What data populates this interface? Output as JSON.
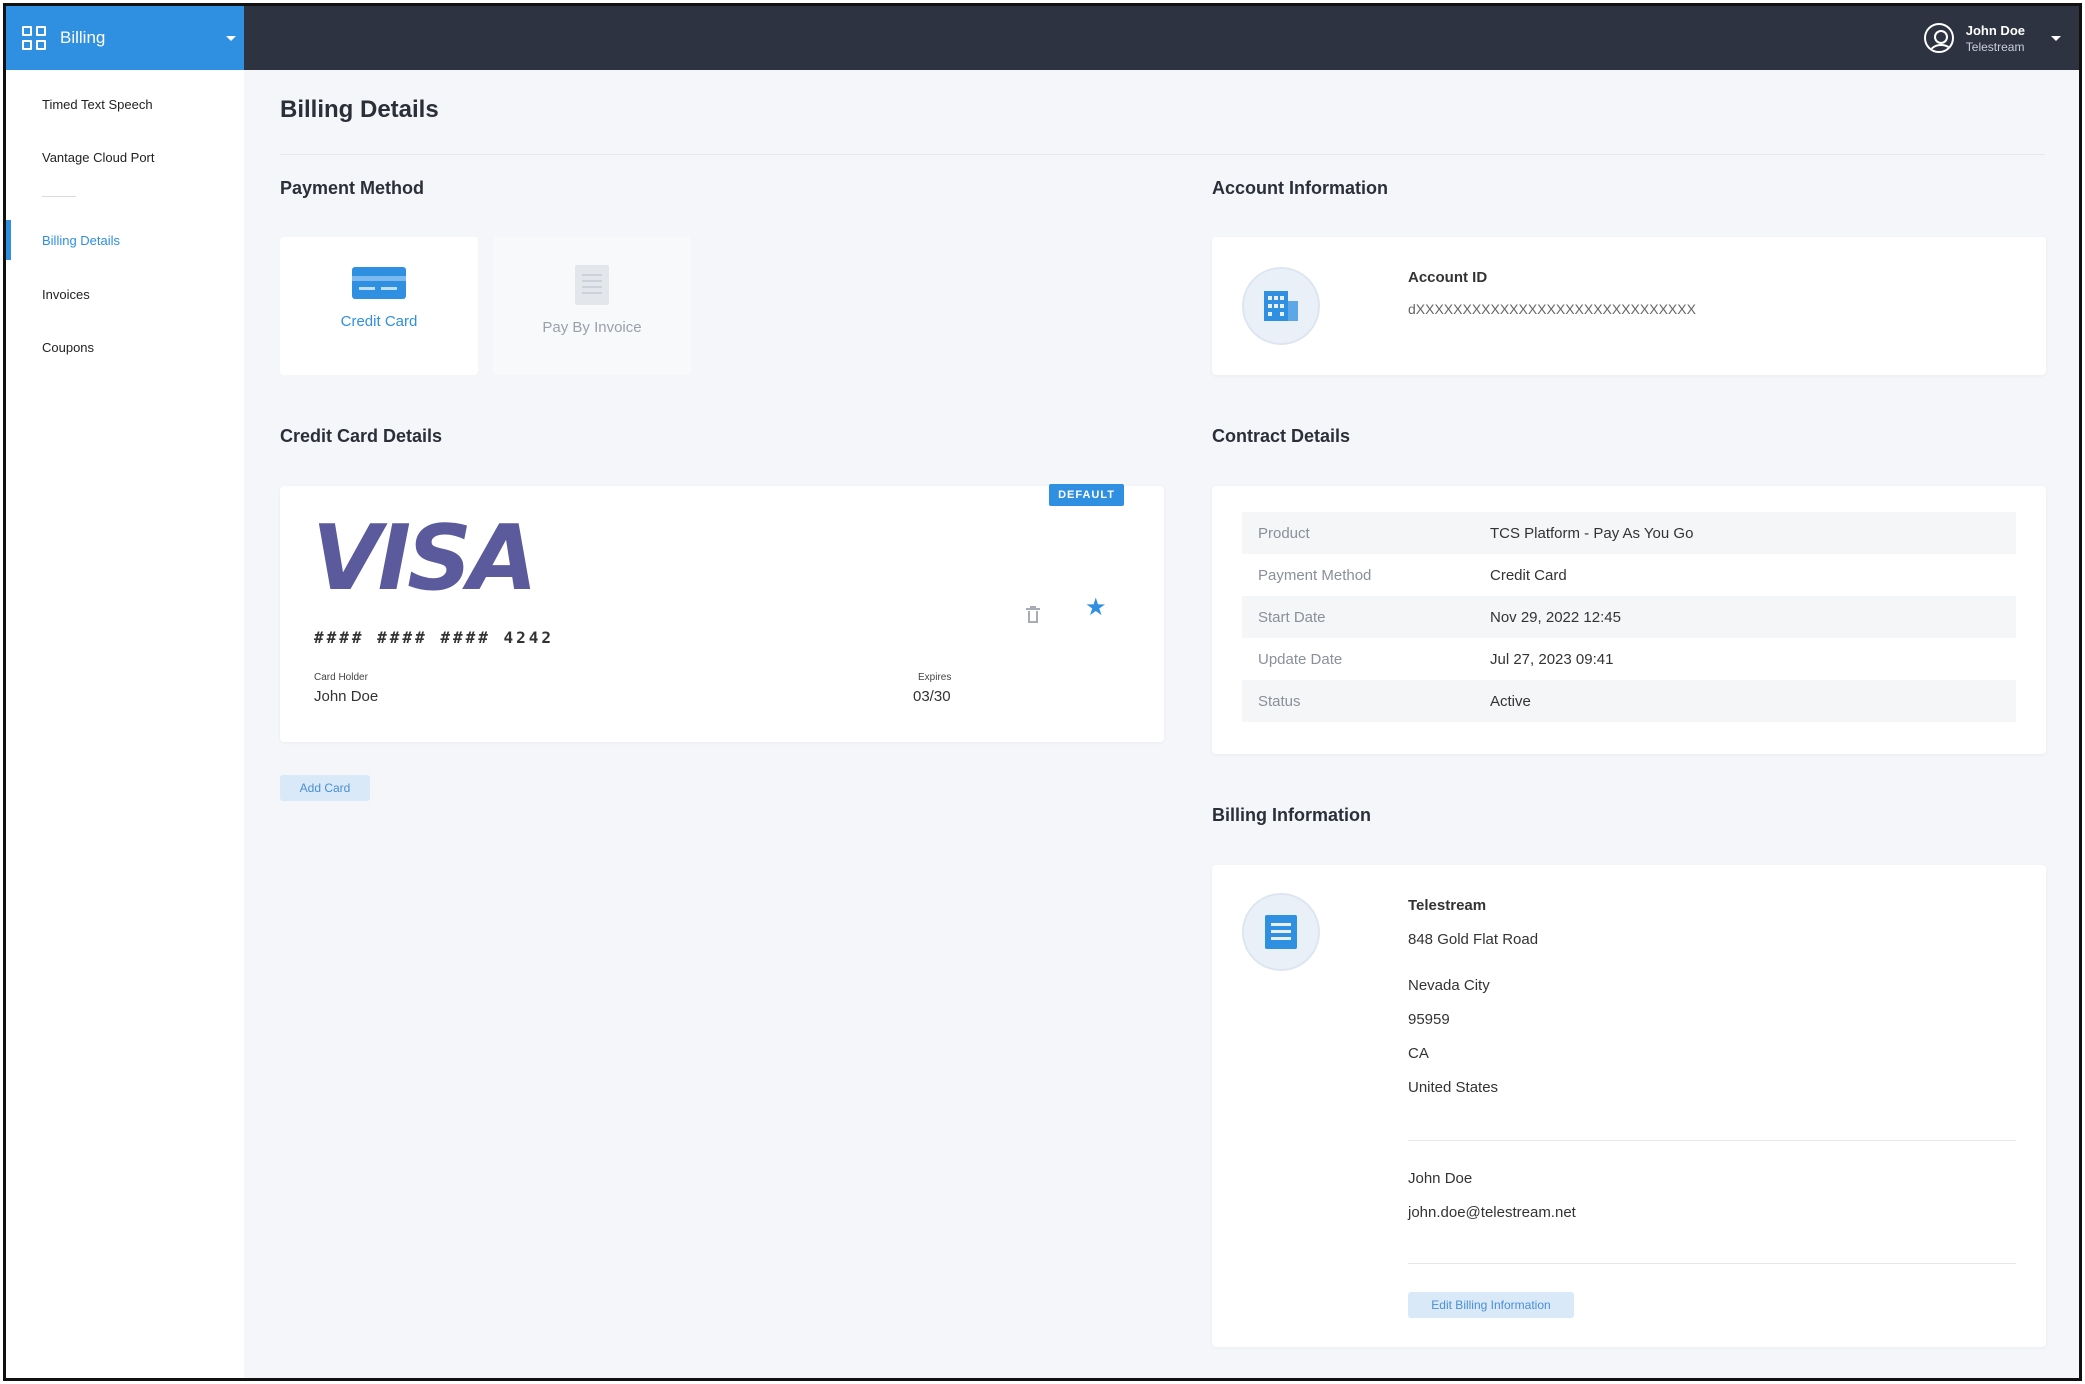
{
  "app": {
    "name": "Billing"
  },
  "user": {
    "name": "John Doe",
    "org": "Telestream"
  },
  "sidebar": {
    "items": [
      {
        "label": "Timed Text Speech"
      },
      {
        "label": "Vantage Cloud Port"
      },
      {
        "label": "Billing Details",
        "active": true
      },
      {
        "label": "Invoices"
      },
      {
        "label": "Coupons"
      }
    ]
  },
  "page": {
    "title": "Billing Details"
  },
  "payment_method": {
    "title": "Payment Method",
    "options": [
      {
        "label": "Credit Card",
        "selected": true,
        "icon": "credit-card-icon"
      },
      {
        "label": "Pay By Invoice",
        "selected": false,
        "icon": "invoice-icon"
      }
    ]
  },
  "credit_card_details": {
    "title": "Credit Card Details",
    "brand": "VISA",
    "number": "#### #### #### 4242",
    "holder_label": "Card Holder",
    "holder": "John Doe",
    "expires_label": "Expires",
    "expires": "03/30",
    "badge": "DEFAULT",
    "add_card_label": "Add Card"
  },
  "account_information": {
    "title": "Account Information",
    "id_label": "Account ID",
    "id_value": "dXXXXXXXXXXXXXXXXXXXXXXXXXXXXXX"
  },
  "contract_details": {
    "title": "Contract Details",
    "rows": [
      {
        "key": "Product",
        "value": "TCS Platform - Pay As You Go"
      },
      {
        "key": "Payment Method",
        "value": "Credit Card"
      },
      {
        "key": "Start Date",
        "value": "Nov 29, 2022 12:45"
      },
      {
        "key": "Update Date",
        "value": "Jul 27, 2023 09:41"
      },
      {
        "key": "Status",
        "value": "Active"
      }
    ]
  },
  "billing_information": {
    "title": "Billing Information",
    "company": "Telestream",
    "address": "848 Gold Flat Road",
    "city": "Nevada City",
    "zip": "95959",
    "state": "CA",
    "country": "United States",
    "contact_name": "John Doe",
    "contact_email": "john.doe@telestream.net",
    "edit_label": "Edit Billing Information"
  },
  "colors": {
    "accent": "#2f8fe0",
    "topbar": "#2d3340",
    "visa": "#5a5a9c"
  }
}
